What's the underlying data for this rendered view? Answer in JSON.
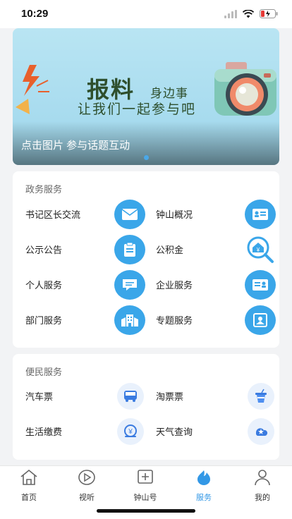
{
  "status_bar": {
    "time": "10:29"
  },
  "banner": {
    "headline": "报料",
    "subtitle1": "身边事",
    "subtitle2": "让我们一起参与吧",
    "caption": "点击图片 参与话题互动"
  },
  "gov_services": {
    "title": "政务服务",
    "items": [
      {
        "label": "书记区长交流",
        "icon": "envelope-icon"
      },
      {
        "label": "钟山概况",
        "icon": "id-card-icon"
      },
      {
        "label": "公示公告",
        "icon": "clipboard-icon"
      },
      {
        "label": "公积金",
        "icon": "housing-fund-icon"
      },
      {
        "label": "个人服务",
        "icon": "chat-bubble-icon"
      },
      {
        "label": "企业服务",
        "icon": "business-card-icon"
      },
      {
        "label": "部门服务",
        "icon": "building-icon"
      },
      {
        "label": "专题服务",
        "icon": "picture-frame-icon"
      }
    ]
  },
  "public_services": {
    "title": "便民服务",
    "items": [
      {
        "label": "汽车票",
        "icon": "bus-icon"
      },
      {
        "label": "淘票票",
        "icon": "ticket-cup-icon"
      },
      {
        "label": "生活缴费",
        "icon": "payment-icon"
      },
      {
        "label": "天气查询",
        "icon": "weather-icon"
      }
    ]
  },
  "tabbar": {
    "items": [
      {
        "label": "首页",
        "icon": "home-icon"
      },
      {
        "label": "视听",
        "icon": "play-icon"
      },
      {
        "label": "钟山号",
        "icon": "add-box-icon"
      },
      {
        "label": "服务",
        "icon": "flame-icon",
        "active": true
      },
      {
        "label": "我的",
        "icon": "user-icon"
      }
    ],
    "active_color": "#3398e6"
  },
  "colors": {
    "accent": "#3aa6e9",
    "banner_text": "#2e4f2d"
  }
}
